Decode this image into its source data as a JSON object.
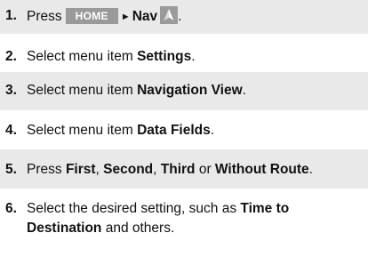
{
  "steps": [
    {
      "num": "1.",
      "pre": "Press",
      "home_key": "HOME",
      "arrow": "►",
      "nav_label": "Nav",
      "post": "."
    },
    {
      "num": "2.",
      "pre": "Select menu item ",
      "bold": "Settings",
      "post": "."
    },
    {
      "num": "3.",
      "pre": "Select menu item ",
      "bold": "Navigation View",
      "post": "."
    },
    {
      "num": "4.",
      "pre": "Select menu item ",
      "bold": "Data Fields",
      "post": "."
    },
    {
      "num": "5.",
      "pre": "Press ",
      "b1": "First",
      "s1": ", ",
      "b2": "Second",
      "s2": ", ",
      "b3": "Third",
      "s3": " or ",
      "b4": "Without Route",
      "post": "."
    },
    {
      "num": "6.",
      "pre": "Select the desired setting, such as ",
      "bold": "Time to Destination",
      "post": " and others."
    }
  ],
  "icons": {
    "nav": "navigation-arrow-icon"
  }
}
